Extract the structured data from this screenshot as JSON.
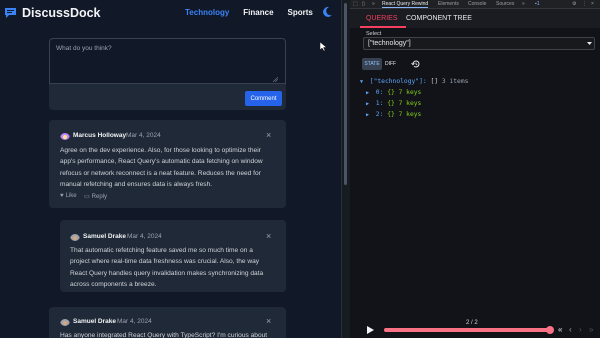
{
  "app": {
    "brand": "DiscussDock",
    "nav": [
      {
        "label": "Technology",
        "active": true
      },
      {
        "label": "Finance",
        "active": false
      },
      {
        "label": "Sports",
        "active": false
      }
    ],
    "theme_icon": "moon-icon",
    "accent": "#3b82f6",
    "composer": {
      "placeholder": "What do you think?",
      "button": "Comment"
    },
    "comments": [
      {
        "author": "Marcus Holloway",
        "date": "Mar 4, 2024",
        "lines": [
          "Agree on the dev experience. Also, for those looking to optimize their",
          "app's performance, React Query's automatic data fetching on window",
          "refocus or network reconnect is a neat feature. Reduces the need for",
          "manual refetching and ensures data is always fresh."
        ],
        "like": "Like",
        "reply": "Reply"
      },
      {
        "author": "Samuel Drake",
        "date": "Mar 4, 2024",
        "lines": [
          "That automatic refetching feature saved me so much time on a",
          "project where real-time data freshness was crucial. Also, the way",
          "React Query handles query invalidation makes synchronizing data",
          "across components a breeze."
        ]
      },
      {
        "author": "Samuel Drake",
        "date": "Mar 4, 2024",
        "lines": [
          "Has anyone integrated React Query with TypeScript? I'm curious about"
        ]
      }
    ]
  },
  "devtools": {
    "tabs": [
      "React Query Rewind",
      "Elements",
      "Console",
      "Sources"
    ],
    "badge": "1",
    "rq_tabs": [
      "QUERIES",
      "COMPONENT TREE"
    ],
    "select_label": "Select",
    "select_value": "[\"technology\"]",
    "views": [
      "STATE",
      "DIFF"
    ],
    "tree": {
      "root_key": "[\"technology\"]",
      "root_open": "[]",
      "root_count": "3 items",
      "items": [
        {
          "key": "0",
          "brace": "{}",
          "count": "7 keys"
        },
        {
          "key": "1",
          "brace": "{}",
          "count": "7 keys"
        },
        {
          "key": "2",
          "brace": "{}",
          "count": "7 keys"
        }
      ]
    },
    "timeline": {
      "step": "2 / 2",
      "progress": 1.0,
      "accent": "#fb7185"
    }
  }
}
